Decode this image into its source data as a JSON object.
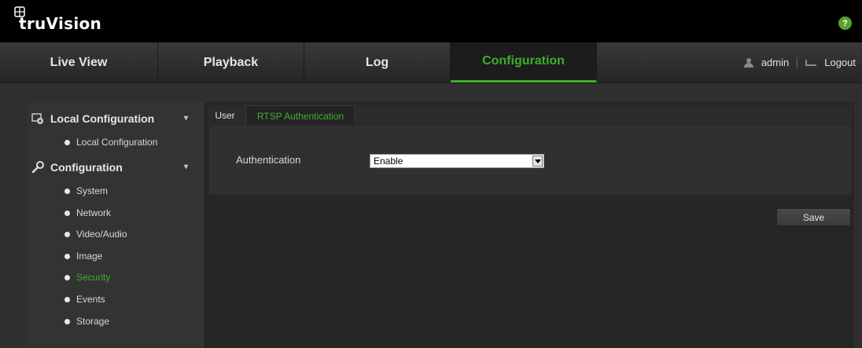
{
  "app": {
    "logo_text": "truVision"
  },
  "colors": {
    "accent": "#3fae2a",
    "background": "#2f2f2f",
    "topbar": "#000000"
  },
  "nav": {
    "tabs": [
      {
        "label": "Live View"
      },
      {
        "label": "Playback"
      },
      {
        "label": "Log"
      },
      {
        "label": "Configuration",
        "active": true
      }
    ],
    "user": "admin",
    "logout": "Logout"
  },
  "sidebar": {
    "groups": [
      {
        "label": "Local Configuration",
        "icon": "local-config-icon",
        "items": [
          {
            "label": "Local Configuration"
          }
        ]
      },
      {
        "label": "Configuration",
        "icon": "wrench-icon",
        "items": [
          {
            "label": "System"
          },
          {
            "label": "Network"
          },
          {
            "label": "Video/Audio"
          },
          {
            "label": "Image"
          },
          {
            "label": "Security",
            "active": true
          },
          {
            "label": "Events"
          },
          {
            "label": "Storage"
          }
        ]
      }
    ]
  },
  "content": {
    "tabs": [
      {
        "label": "User"
      },
      {
        "label": "RTSP Authentication",
        "active": true
      }
    ],
    "authentication": {
      "label": "Authentication",
      "value": "Enable"
    },
    "save_label": "Save"
  }
}
